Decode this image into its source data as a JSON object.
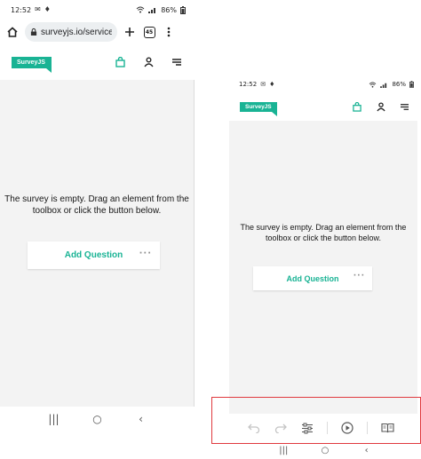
{
  "left_phone": {
    "status": {
      "time": "12:52",
      "battery": "86%"
    },
    "browser": {
      "url": "surveyjs.io/service/e",
      "tab_count": "45"
    },
    "header": {
      "logo": "SurveyJS"
    },
    "canvas": {
      "empty_message": "The survey is empty. Drag an element from the toolbox or click the button below.",
      "add_question_label": "Add Question",
      "more_label": "···"
    },
    "nav": {
      "recents": "|||",
      "home": "○",
      "back": "‹"
    }
  },
  "right_phone": {
    "status": {
      "time": "12:52",
      "battery": "86%"
    },
    "header": {
      "logo": "SurveyJS"
    },
    "canvas": {
      "empty_message": "The survey is empty. Drag an element from the toolbox or click the button below.",
      "add_question_label": "Add Question",
      "more_label": "···"
    },
    "toolbar": {
      "icons": [
        "undo-icon",
        "redo-icon",
        "settings-icon",
        "preview-icon",
        "book-icon"
      ]
    },
    "nav": {
      "recents": "|||",
      "home": "○",
      "back": "‹"
    }
  },
  "colors": {
    "accent": "#19b394",
    "highlight": "#e0393e",
    "canvas": "#f3f3f3"
  }
}
